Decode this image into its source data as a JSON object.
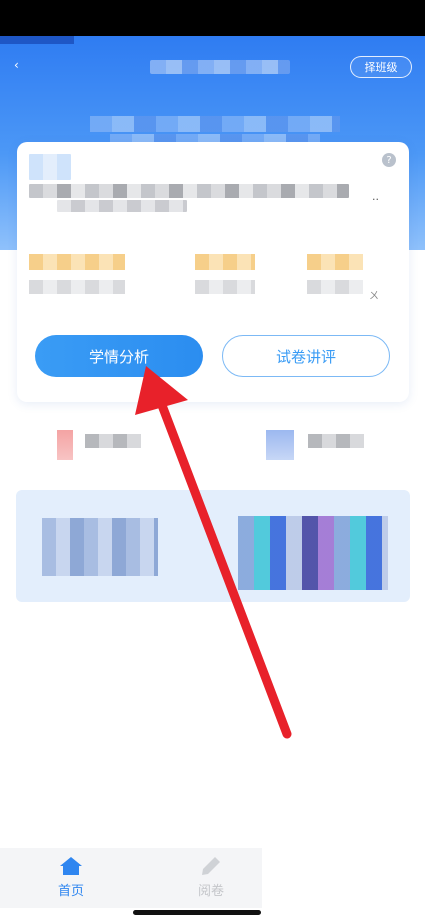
{
  "header": {
    "switch_class_label": "择班级"
  },
  "card": {
    "ellipsis": "..",
    "side_mark": "ㄨ",
    "help_glyph": "?",
    "buttons": {
      "analysis_label": "学情分析",
      "review_label": "试卷讲评"
    }
  },
  "tabbar": {
    "home_label": "首页",
    "grading_label": "阅卷"
  },
  "colors": {
    "primary": "#3a9cf5",
    "hero_top": "#2f7cf2",
    "annotation_arrow": "#e8212a"
  },
  "icons": {
    "back": "chevron-left-icon",
    "help": "question-icon",
    "home": "home-icon",
    "grading": "pencil-icon"
  }
}
